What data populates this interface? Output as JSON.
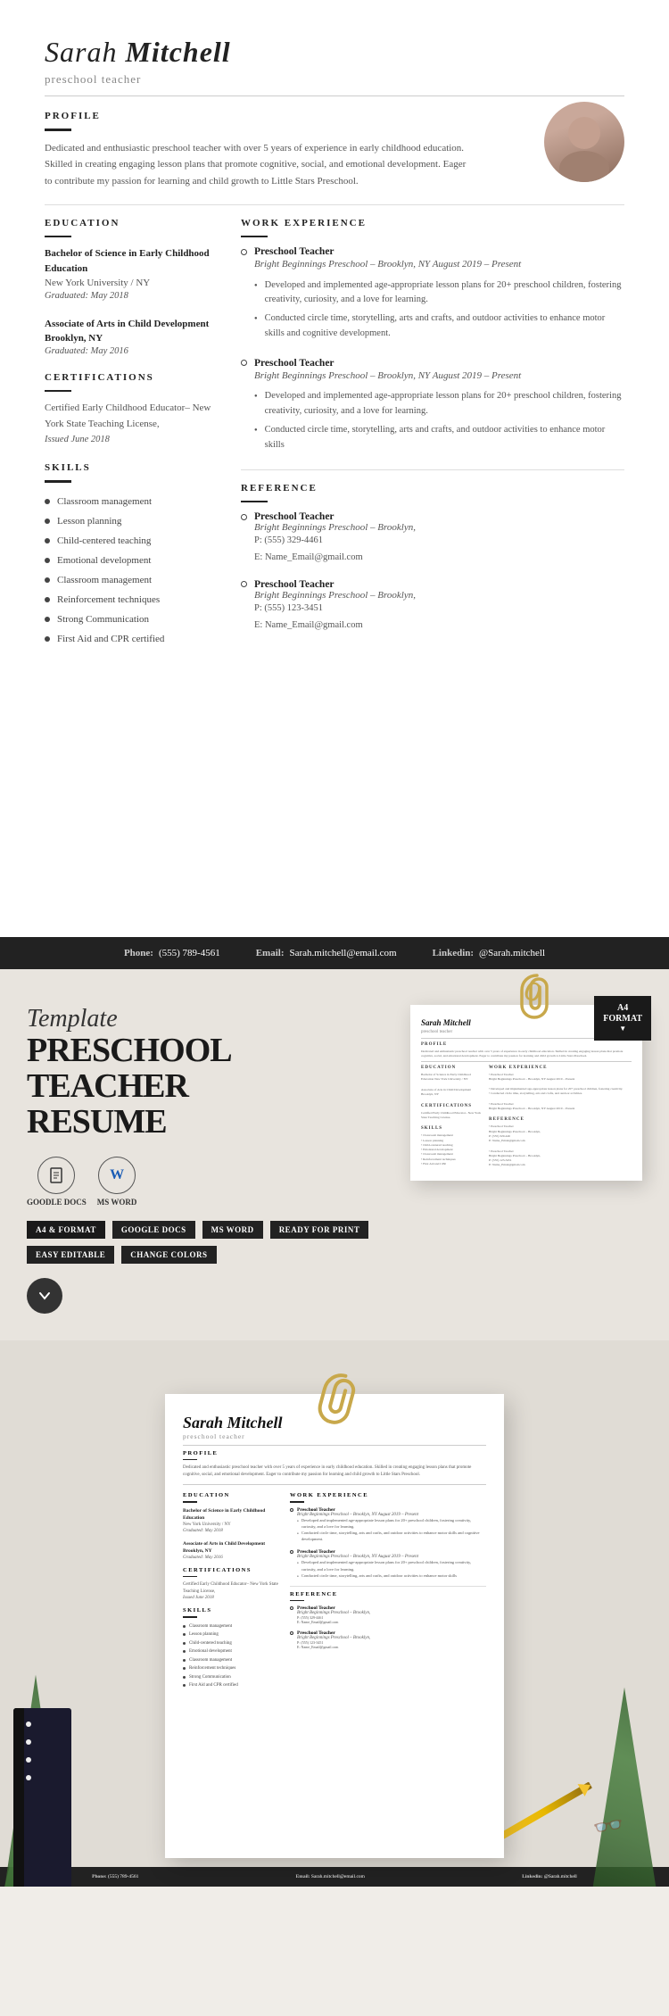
{
  "header": {
    "first_name": "Sarah",
    "last_name": "Mitchell",
    "title": "preschool teacher"
  },
  "profile": {
    "section_title": "PROFILE",
    "text": "Dedicated and enthusiastic preschool teacher with over 5 years of experience in early childhood education. Skilled in creating engaging lesson plans that promote cognitive, social, and emotional development. Eager to contribute my passion for learning and child growth to Little Stars Preschool."
  },
  "education": {
    "section_title": "EDUCATION",
    "items": [
      {
        "degree": "Bachelor of Science in Early Childhood Education",
        "school": "New York University / NY",
        "graduated": "Graduated: May 2018"
      },
      {
        "degree": "Associate of Arts in Child Development Brooklyn, NY",
        "school": "",
        "graduated": "Graduated: May 2016"
      }
    ]
  },
  "certifications": {
    "section_title": "CERTIFICATIONS",
    "text": "Certified Early Childhood Educator– New York State Teaching License,",
    "issued": "Issued June 2018"
  },
  "skills": {
    "section_title": "SKILLS",
    "items": [
      "Classroom management",
      "Lesson planning",
      "Child-centered teaching",
      "Emotional development",
      "Classroom management",
      "Reinforcement techniques",
      "Strong Communication",
      "First Aid and CPR certified"
    ]
  },
  "work_experience": {
    "section_title": "WORK EXPERIENCE",
    "items": [
      {
        "title": "Preschool Teacher",
        "company": "Bright Beginnings Preschool – Brooklyn, NY August 2019 – Present",
        "bullets": [
          "Developed and implemented age-appropriate lesson plans for 20+ preschool children, fostering creativity, curiosity, and a love for learning.",
          "Conducted circle time, storytelling, arts and crafts, and outdoor activities to enhance motor skills and cognitive development."
        ]
      },
      {
        "title": "Preschool Teacher",
        "company": "Bright Beginnings Preschool – Brooklyn, NY August 2019 – Present",
        "bullets": [
          "Developed and implemented age-appropriate lesson plans for 20+ preschool children, fostering creativity, curiosity, and a love for learning.",
          "Conducted circle time, storytelling, arts and crafts, and outdoor activities to enhance motor skills"
        ]
      }
    ]
  },
  "reference": {
    "section_title": "REFERENCE",
    "items": [
      {
        "title": "Preschool Teacher",
        "company": "Bright Beginnings Preschool – Brooklyn,",
        "phone": "P: (555) 329-4461",
        "email": "E: Name_Email@gmail.com"
      },
      {
        "title": "Preschool Teacher",
        "company": "Bright Beginnings Preschool – Brooklyn,",
        "phone": "P: (555) 123-3451",
        "email": "E: Name_Email@gmail.com"
      }
    ]
  },
  "footer": {
    "phone_label": "Phone:",
    "phone": "(555) 789-4561",
    "email_label": "Email:",
    "email": "Sarah.mitchell@email.com",
    "linkedin_label": "Linkedin:",
    "linkedin": "@Sarah.mitchell"
  },
  "promo": {
    "template_label": "Template",
    "title_line1": "PRESCHOOL",
    "title_line2": "TEACHER",
    "title_line3": "RESUME",
    "icon1_label": "GOODLE\nDOCS",
    "icon2_label": "MS\nWORD",
    "tags": [
      "A4 & FORMAT",
      "GOOGLE DOCS",
      "MS WORD",
      "READY FOR PRINT",
      "EASY EDITABLE",
      "CHANGE COLORS"
    ],
    "format_badge_line1": "A4",
    "format_badge_line2": "FORMAT"
  }
}
